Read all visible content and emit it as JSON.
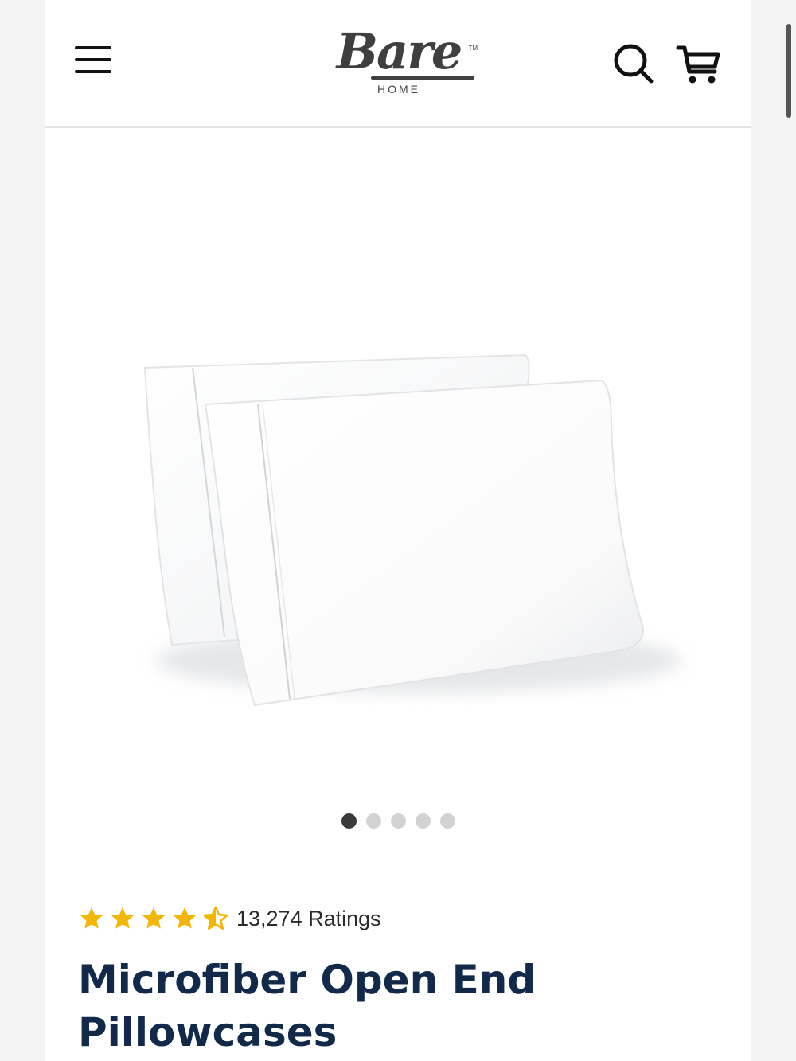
{
  "brand": {
    "name": "Bare",
    "trademark": "TM",
    "sub": "HOME"
  },
  "header": {
    "icons": [
      "menu-icon",
      "search-icon",
      "cart-icon"
    ]
  },
  "carousel": {
    "total_slides": 5,
    "active_index": 0
  },
  "product": {
    "rating_value": 4.5,
    "rating_max": 5,
    "ratings_text": "13,274 Ratings",
    "title_line1": "Microfiber Open End",
    "title_line2": "Pillowcases"
  },
  "colors": {
    "brand_gray": "#3f3f3f",
    "title_navy": "#12294a",
    "star_gold": "#f2b705"
  }
}
